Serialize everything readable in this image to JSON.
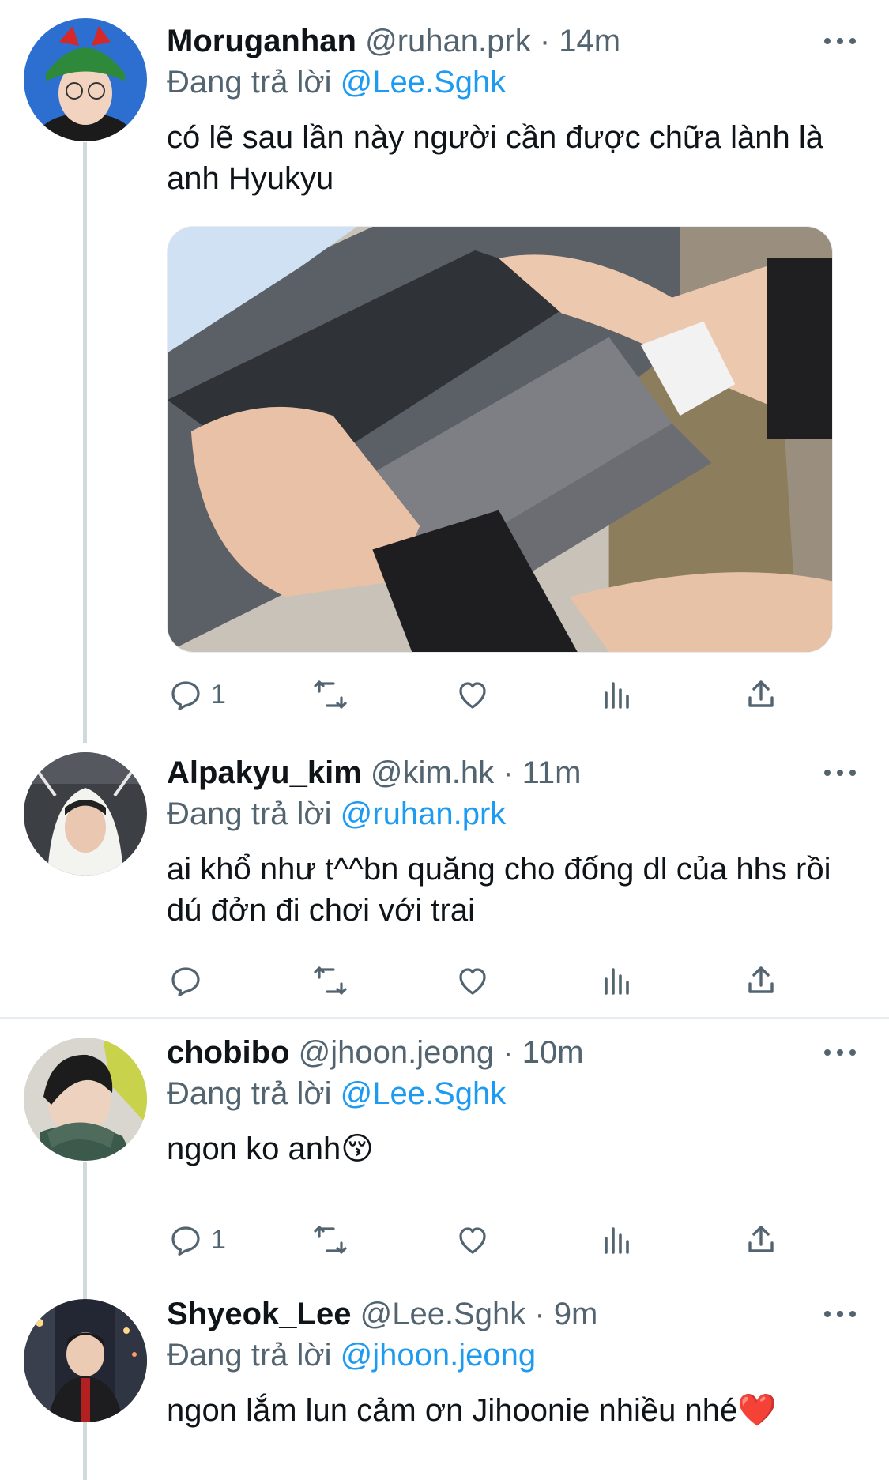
{
  "tweets": [
    {
      "name": "Moruganhan",
      "handle": "@ruhan.prk",
      "time": "14m",
      "reply_prefix": "Đang trả lời",
      "reply_to": "@Lee.Sghk",
      "text": "có lẽ sau lần này người cần được chữa lành là anh Hyukyu",
      "has_media": true,
      "reply_count": "1",
      "retweet_count": "",
      "like_count": ""
    },
    {
      "name": "Alpakyu_kim",
      "handle": "@kim.hk",
      "time": "11m",
      "reply_prefix": "Đang trả lời",
      "reply_to": "@ruhan.prk",
      "text": "ai khổ như t^^bn quăng cho đống dl của hhs rồi dú đởn đi chơi với trai",
      "reply_count": "",
      "retweet_count": "",
      "like_count": ""
    },
    {
      "name": "chobibo",
      "handle": "@jhoon.jeong",
      "time": "10m",
      "reply_prefix": "Đang trả lời",
      "reply_to": "@Lee.Sghk",
      "text": "ngon ko anh😚",
      "reply_count": "1",
      "retweet_count": "",
      "like_count": ""
    },
    {
      "name": "Shyeok_Lee",
      "handle": "@Lee.Sghk",
      "time": "9m",
      "reply_prefix": "Đang trả lời",
      "reply_to": "@jhoon.jeong",
      "text": "ngon lắm lun cảm ơn Jihoonie nhiều nhé❤️"
    }
  ],
  "separator": "·",
  "colors": {
    "text": "#0f1419",
    "secondary": "#536471",
    "link": "#1d9bf0",
    "thread_line": "#cfd9de",
    "divider": "#e6ecf0"
  },
  "icons": [
    "reply-icon",
    "retweet-icon",
    "like-icon",
    "views-icon",
    "share-icon",
    "more-icon"
  ]
}
